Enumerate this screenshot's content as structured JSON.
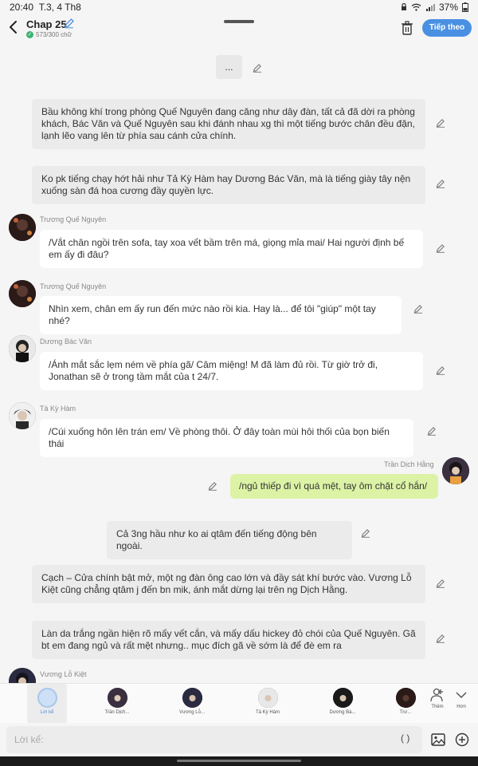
{
  "status": {
    "time": "20:40",
    "date": "T.3, 4 Th8",
    "battery": "37%"
  },
  "header": {
    "title": "Chap 25",
    "subtitle": "573/300 chữ",
    "follow_label": "Tiếp theo"
  },
  "messages": {
    "ellipsis": "...",
    "n1": "Bầu không khí trong phòng Quế Nguyên đang căng như dây đàn, tất cả đã dời ra phòng khách, Bác Văn và Quế Nguyên sau khi đánh nhau xg thì một tiếng bước chân đều đặn, lạnh lẽo vang lên từ phía sau cánh cửa chính.",
    "n2": "Ko pk tiếng chạy hớt hải như Tả Kỳ Hàm hay Dương Bác Văn, mà là tiếng giày tây nện xuống sàn đá hoa cương đầy quyền lực.",
    "c1_name": "Trương Quế Nguyên",
    "c1_text": "/Vắt chân ngồi trên sofa, tay xoa vết bầm trên má, giọng mỉa mai/ Hai người định bế em ấy đi đâu?",
    "c2_name": "Trương Quế Nguyên",
    "c2_text": "Nhìn xem, chân em ấy run đến mức nào rồi kia. Hay là... để tôi \"giúp\" một tay nhé?",
    "c3_name": "Dương Bác Văn",
    "c3_text": "/Ánh mắt sắc lẹm ném về phía gã/ Câm miệng! M đã làm đủ rồi. Từ giờ trở đi, Jonathan sẽ ở trong tầm mắt của t 24/7.",
    "c4_name": "Tả Kỳ Hàm",
    "c4_text": "/Cúi xuống hôn lên trán em/ Về phòng thôi. Ở đây toàn mùi hôi thối của bọn biến thái",
    "c5_name": "Trần Dịch Hằng",
    "c5_text": "/ngủ thiếp đi vì quá mệt, tay ôm chặt cổ hắn/",
    "n3": "Cả 3ng hầu như ko ai qtâm đến tiếng động bên ngoài.",
    "n4": "Cạch – Cửa chính bật mở, một ng đàn ông cao lớn và đầy sát khí bước vào. Vương Lỗ Kiệt cũng chẳng qtâm j đến bn mik, ánh mắt dừng lại trên ng Dịch Hằng.",
    "n5": "Làn da trắng ngần hiện rõ mấy vết cắn, và mấy dấu hickey đỏ chói của Quế Nguyên. Gã bt em đang ngủ và rất mệt nhưng.. mục đích gã về sớm là để đè em ra",
    "c6_name": "Vương Lỗ Kiệt"
  },
  "characters": [
    {
      "label": "Lời kể"
    },
    {
      "label": "Trần Dịch..."
    },
    {
      "label": "Vương Lỗ..."
    },
    {
      "label": "Tả Kỳ Hàm"
    },
    {
      "label": "Dương Bá..."
    },
    {
      "label": "Trư..."
    }
  ],
  "side_buttons": {
    "add_label": "Thêm",
    "more_label": "Hơn"
  },
  "input": {
    "placeholder": "Lời kể:",
    "paren": "( )"
  },
  "colors": {
    "accent": "#4a90e2",
    "own_bubble": "#dcf3a6",
    "narration_bubble": "#ebebeb"
  },
  "icons": [
    "back-arrow-icon",
    "pencil-icon",
    "check-icon",
    "trash-icon",
    "person-add-icon",
    "chevron-down-icon",
    "image-icon",
    "plus-circle-icon"
  ]
}
